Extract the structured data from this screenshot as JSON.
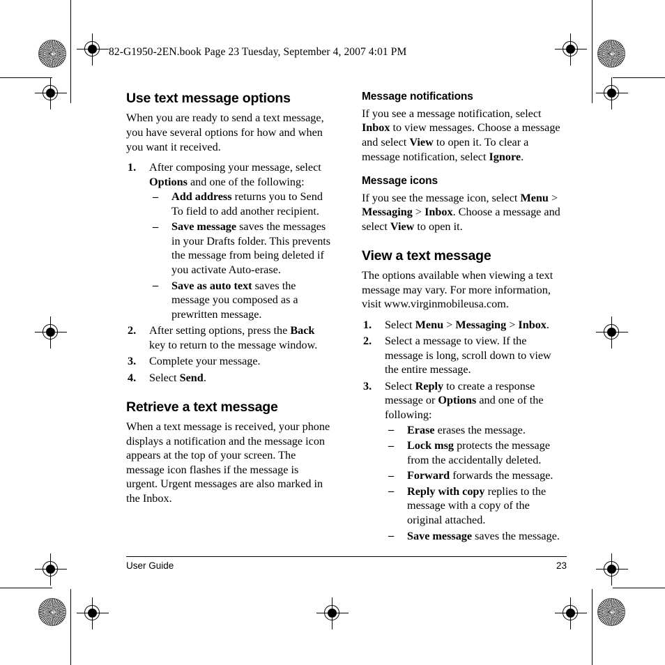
{
  "slug": "82-G1950-2EN.book  Page 23  Tuesday, September 4, 2007  4:01 PM",
  "left_column": {
    "section1": {
      "heading": "Use text message options",
      "intro": "When you are ready to send a text message, you have several options for how and when you want it received.",
      "steps": [
        {
          "num": "1.",
          "text_parts": [
            "After composing your message, select ",
            "Options",
            " and one of the following:"
          ],
          "sub_bullets": [
            {
              "dash": "–",
              "bold": "Add address",
              "rest": " returns you to Send To field to add another recipient."
            },
            {
              "dash": "–",
              "bold": "Save message",
              "rest": " saves the messages in your Drafts folder. This prevents the message from being deleted if you activate Auto-erase."
            },
            {
              "dash": "–",
              "bold": "Save as auto text",
              "rest": " saves the message you composed as a prewritten message."
            }
          ]
        },
        {
          "num": "2.",
          "pre": "After setting options, press the ",
          "bold": "Back",
          "post": " key to return to the message window."
        },
        {
          "num": "3.",
          "pre": "Complete your message.",
          "bold": "",
          "post": ""
        },
        {
          "num": "4.",
          "pre": "Select ",
          "bold": "Send",
          "post": "."
        }
      ]
    },
    "section2": {
      "heading": "Retrieve a text message",
      "body": "When a text message is received, your phone displays a notification and the message icon appears at the top of your screen. The message icon flashes if the message is urgent. Urgent messages are also marked in the Inbox."
    }
  },
  "right_column": {
    "sub1": {
      "heading": "Message notifications",
      "parts": [
        "If you see a message notification, select ",
        "Inbox",
        " to view messages. Choose a message and select ",
        "View",
        " to open it. To clear a message notification, select ",
        "Ignore",
        "."
      ]
    },
    "sub2": {
      "heading": "Message icons",
      "parts": [
        "If you see the message icon, select ",
        "Menu",
        " > ",
        "Messaging",
        " > ",
        "Inbox",
        ". Choose a message and select ",
        "View",
        " to open it."
      ]
    },
    "section3": {
      "heading": "View a text message",
      "intro": "The options available when viewing a text message may vary. For more information, visit www.virginmobileusa.com.",
      "steps": [
        {
          "num": "1.",
          "parts": [
            "Select ",
            "Menu",
            " > ",
            "Messaging",
            " > ",
            "Inbox",
            "."
          ]
        },
        {
          "num": "2.",
          "plain": "Select a message to view. If the message is long, scroll down to view the entire message."
        },
        {
          "num": "3.",
          "pre": "Select ",
          "bold1": "Reply",
          "mid": " to create a response message or ",
          "bold2": "Options",
          "post": " and one of the following:",
          "sub_bullets": [
            {
              "dash": "–",
              "bold": "Erase",
              "rest": " erases the message."
            },
            {
              "dash": "–",
              "bold": "Lock msg",
              "rest": " protects the message from the accidentally deleted."
            },
            {
              "dash": "–",
              "bold": "Forward",
              "rest": " forwards the message."
            },
            {
              "dash": "–",
              "bold": "Reply with copy",
              "rest": " replies to the message with a copy of the original attached."
            },
            {
              "dash": "–",
              "bold": "Save message",
              "rest": " saves the message."
            }
          ]
        }
      ]
    }
  },
  "footer": {
    "left": "User Guide",
    "page_number": "23"
  }
}
